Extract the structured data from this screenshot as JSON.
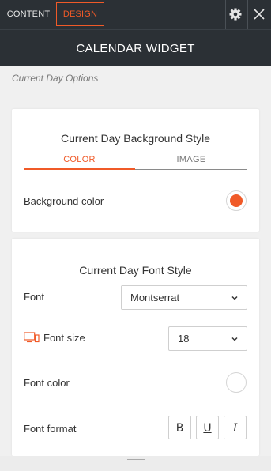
{
  "topbar": {
    "tabs": [
      {
        "label": "CONTENT"
      },
      {
        "label": "DESIGN"
      }
    ],
    "settings_icon": "gear-icon",
    "close_icon": "close-icon"
  },
  "title": "CALENDAR WIDGET",
  "section_label": "Current Day Options",
  "background_card": {
    "title": "Current Day Background Style",
    "tabs": [
      "COLOR",
      "IMAGE"
    ],
    "active_tab": "COLOR",
    "background_color_label": "Background color",
    "background_color": "#f05a28"
  },
  "font_card": {
    "title": "Current Day Font Style",
    "font_label": "Font",
    "font_value": "Montserrat",
    "font_size_label": "Font size",
    "font_size_icon": "devices-icon",
    "font_size_value": "18",
    "font_color_label": "Font color",
    "font_color": "#ffffff",
    "font_format_label": "Font format",
    "format_buttons": [
      {
        "label": "B",
        "icon": "bold-icon"
      },
      {
        "label": "U",
        "icon": "underline-icon"
      },
      {
        "label": "I",
        "icon": "italic-icon"
      }
    ]
  },
  "colors": {
    "accent": "#f05a28",
    "header_bg": "#2b3035"
  }
}
